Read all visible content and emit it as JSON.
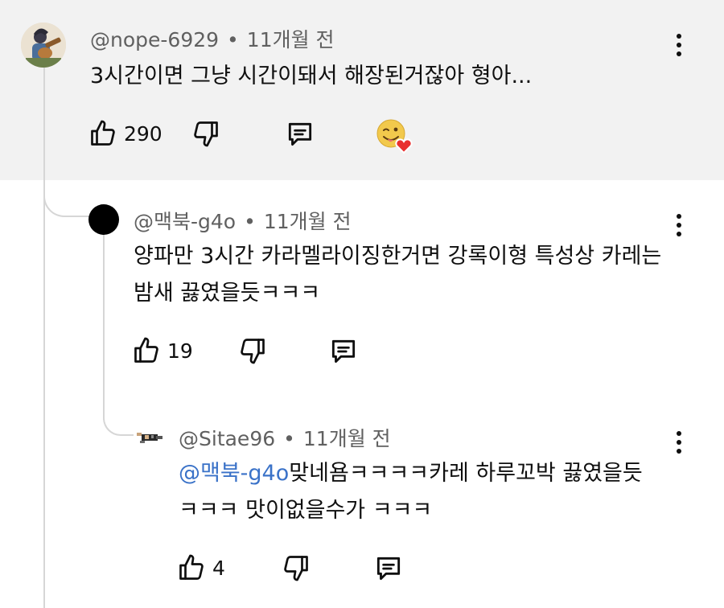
{
  "comments": [
    {
      "handle": "@nope-6929",
      "separator": "•",
      "time": "11개월 전",
      "text": "3시간이면 그냥 시간이돼서 해장된거잖아 형아...",
      "likes": "290",
      "avatar": "avatar-person-guitar",
      "heart_badge": true
    },
    {
      "handle": "@맥북-g4o",
      "separator": "•",
      "time": "11개월 전",
      "text": "양파만 3시간 카라멜라이징한거면 강록이형 특성상 카레는 밤새 끓였을듯ㅋㅋㅋ",
      "likes": "19",
      "avatar": "avatar-black-circle"
    },
    {
      "handle": "@Sitae96",
      "separator": "•",
      "time": "11개월 전",
      "mention": "@맥북-g4o",
      "text": "맞네욤ㅋㅋㅋㅋ카레 하루꼬박 끓였을듯 ㅋㅋㅋ 맛이없을수가 ㅋㅋㅋ",
      "likes": "4",
      "avatar": "avatar-pixel-figure"
    }
  ],
  "colors": {
    "highlight_bg": "#f2f2f2",
    "mention": "#3a72c8",
    "meta": "#606060",
    "thread_line": "#d6d6d6",
    "heart": "#e8302f"
  },
  "icons": [
    "like-icon",
    "dislike-icon",
    "reply-icon",
    "more-vert-icon",
    "creator-heart-icon"
  ]
}
